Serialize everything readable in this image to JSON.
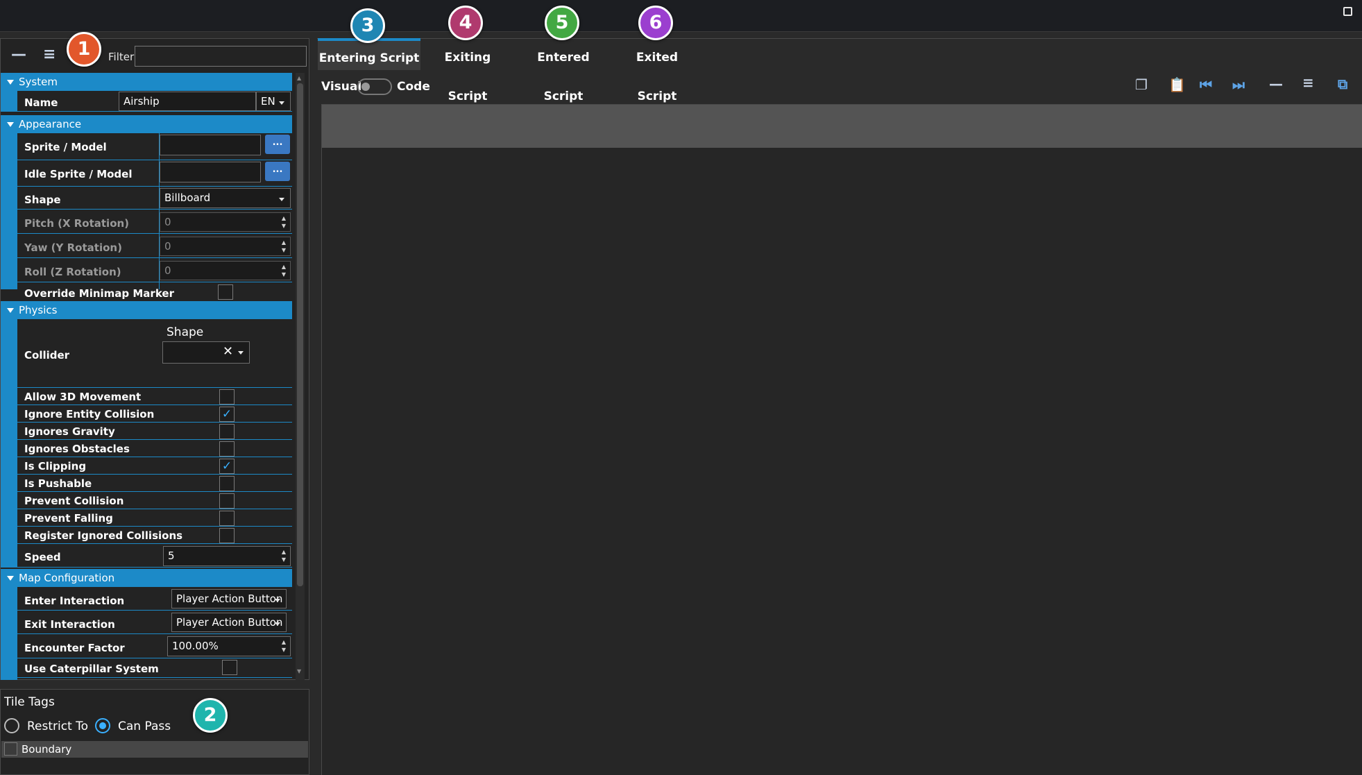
{
  "toolbar": {
    "collapse_icon": "minus-icon",
    "expand_icon": "list-icon",
    "filter_label": "Filter",
    "filter_value": ""
  },
  "sections": {
    "system": "System",
    "appearance": "Appearance",
    "physics": "Physics",
    "map_configuration": "Map Configuration"
  },
  "system": {
    "name_label": "Name",
    "name_value": "Airship",
    "lang": "EN"
  },
  "appearance": {
    "sprite_label": "Sprite / Model",
    "idle_sprite_label": "Idle Sprite / Model",
    "browse_label": "...",
    "shape_label": "Shape",
    "shape_value": "Billboard",
    "pitch_label": "Pitch (X Rotation)",
    "pitch_value": "0",
    "yaw_label": "Yaw (Y Rotation)",
    "yaw_value": "0",
    "roll_label": "Roll (Z Rotation)",
    "roll_value": "0",
    "override_label": "Override Minimap Marker"
  },
  "physics": {
    "collider_label": "Collider",
    "collider_shape_label": "Shape",
    "clear_glyph": "✕",
    "checks": [
      {
        "label": "Allow 3D Movement",
        "checked": false
      },
      {
        "label": "Ignore Entity Collision",
        "checked": true
      },
      {
        "label": "Ignores Gravity",
        "checked": false
      },
      {
        "label": "Ignores Obstacles",
        "checked": false
      },
      {
        "label": "Is Clipping",
        "checked": true
      },
      {
        "label": "Is Pushable",
        "checked": false
      },
      {
        "label": "Prevent Collision",
        "checked": false
      },
      {
        "label": "Prevent Falling",
        "checked": false
      },
      {
        "label": "Register Ignored Collisions",
        "checked": false
      }
    ],
    "speed_label": "Speed",
    "speed_value": "5"
  },
  "map": {
    "enter_label": "Enter Interaction",
    "enter_value": "Player Action Button",
    "exit_label": "Exit Interaction",
    "exit_value": "Player Action Button",
    "encounter_label": "Encounter Factor",
    "encounter_value": "100.00%",
    "caterpillar_label": "Use Caterpillar System"
  },
  "tile_tags": {
    "title": "Tile Tags",
    "restrict_label": "Restrict To",
    "can_pass_label": "Can Pass",
    "items": [
      "Boundary"
    ]
  },
  "tabs": [
    "Entering Script",
    "Exiting Script",
    "Entered Script",
    "Exited Script"
  ],
  "script_toolbar": {
    "visual_label": "Visual",
    "code_label": "Code",
    "icons": [
      "copy-icon",
      "paste-icon",
      "skip-start-icon",
      "skip-end-icon",
      "collapse-icon",
      "expand-icon",
      "popout-icon"
    ]
  },
  "badges": [
    {
      "label": "1",
      "color": "#e2572b"
    },
    {
      "label": "2",
      "color": "#1fb5ad"
    },
    {
      "label": "3",
      "color": "#1f86b3"
    },
    {
      "label": "4",
      "color": "#b03a6e"
    },
    {
      "label": "5",
      "color": "#43a843"
    },
    {
      "label": "6",
      "color": "#9b3fcf"
    }
  ],
  "colors": {
    "accent": "#1c8ac8",
    "check": "#3ab0ff"
  }
}
